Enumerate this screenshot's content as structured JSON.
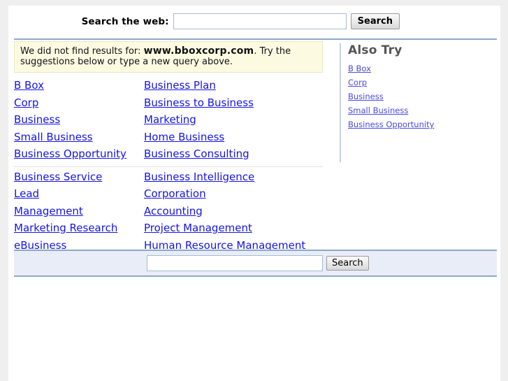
{
  "top_search": {
    "label": "Search the web:",
    "input_value": "",
    "input_placeholder": "",
    "button_label": "Search"
  },
  "notice": {
    "prefix": "We did not find results for: ",
    "query": "www.bboxcorp.com",
    "suffix": ". Try the suggestions below or type a new query above."
  },
  "suggestions": {
    "group1": [
      {
        "left": "B Box",
        "right": "Business Plan"
      },
      {
        "left": "Corp",
        "right": "Business to Business"
      },
      {
        "left": "Business",
        "right": "Marketing"
      },
      {
        "left": "Small Business",
        "right": "Home Business"
      },
      {
        "left": "Business Opportunity",
        "right": "Business Consulting"
      }
    ],
    "group2": [
      {
        "left": "Business Service",
        "right": "Business Intelligence"
      },
      {
        "left": "Lead",
        "right": "Corporation"
      },
      {
        "left": "Management",
        "right": "Accounting"
      },
      {
        "left": "Marketing Research",
        "right": "Project Management"
      },
      {
        "left": "eBusiness",
        "right": "Human Resource Management"
      }
    ]
  },
  "also_try": {
    "heading": "Also Try",
    "items": [
      "B Box",
      "Corp",
      "Business",
      "Small Business",
      "Business Opportunity"
    ]
  },
  "bottom_search": {
    "input_value": "",
    "input_placeholder": "",
    "button_label": "Search"
  },
  "colors": {
    "page_background": "#efefef",
    "sheet": "#ffffff",
    "rule_blue": "#8fa8c8",
    "notice_background": "#fdfae2",
    "notice_border": "#ece7bf",
    "link_blue": "#1414e8",
    "sidebar_link_blue": "#4a4ae0",
    "sidebar_heading_gray": "#555555",
    "bottom_bar_background": "#e9edf7"
  }
}
